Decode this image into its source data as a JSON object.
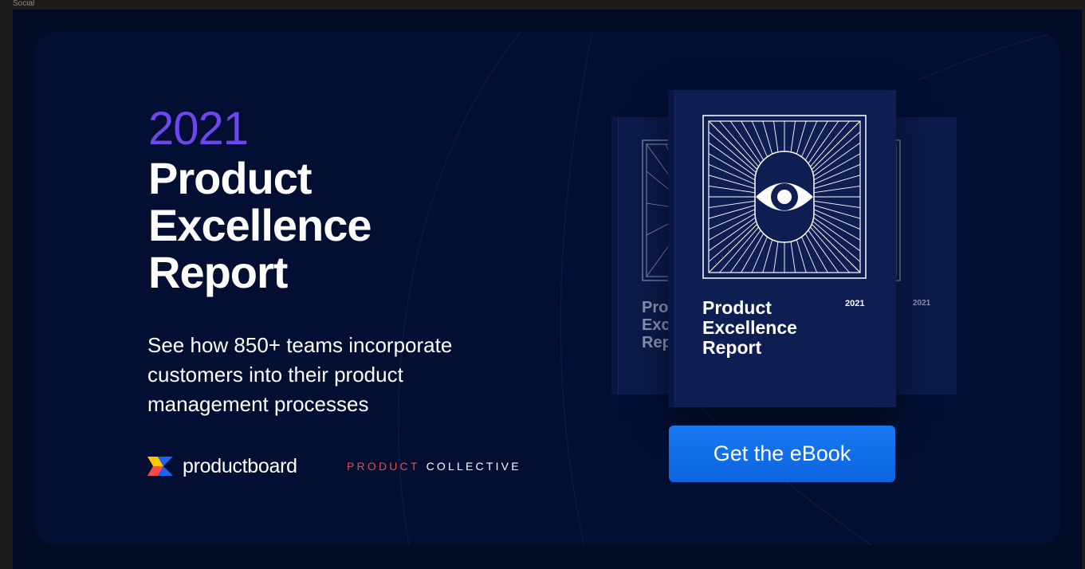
{
  "frame": {
    "label": "Social"
  },
  "hero": {
    "year": "2021",
    "title_lines": [
      "Product",
      "Excellence",
      "Report"
    ],
    "subtitle_lines": [
      "See how 850+ teams incorporate",
      "customers into their product",
      "management processes"
    ]
  },
  "brands": {
    "productboard": "productboard",
    "product_collective_red": "PRODUCT",
    "product_collective_white": "COLLECTIVE"
  },
  "book": {
    "front_title_lines": [
      "Product",
      "Excellence",
      "Report"
    ],
    "front_year": "2021",
    "back_title_lines": [
      "Pro",
      "Exc",
      "Rep"
    ],
    "back_year": "2021",
    "icon": "eye-icon"
  },
  "cta": {
    "label": "Get the eBook"
  },
  "colors": {
    "background": "#000b26",
    "card": "#020f33",
    "accent_purple": "#6b47ec",
    "cta_blue": "#1878f2",
    "collective_red": "#e8494a"
  }
}
